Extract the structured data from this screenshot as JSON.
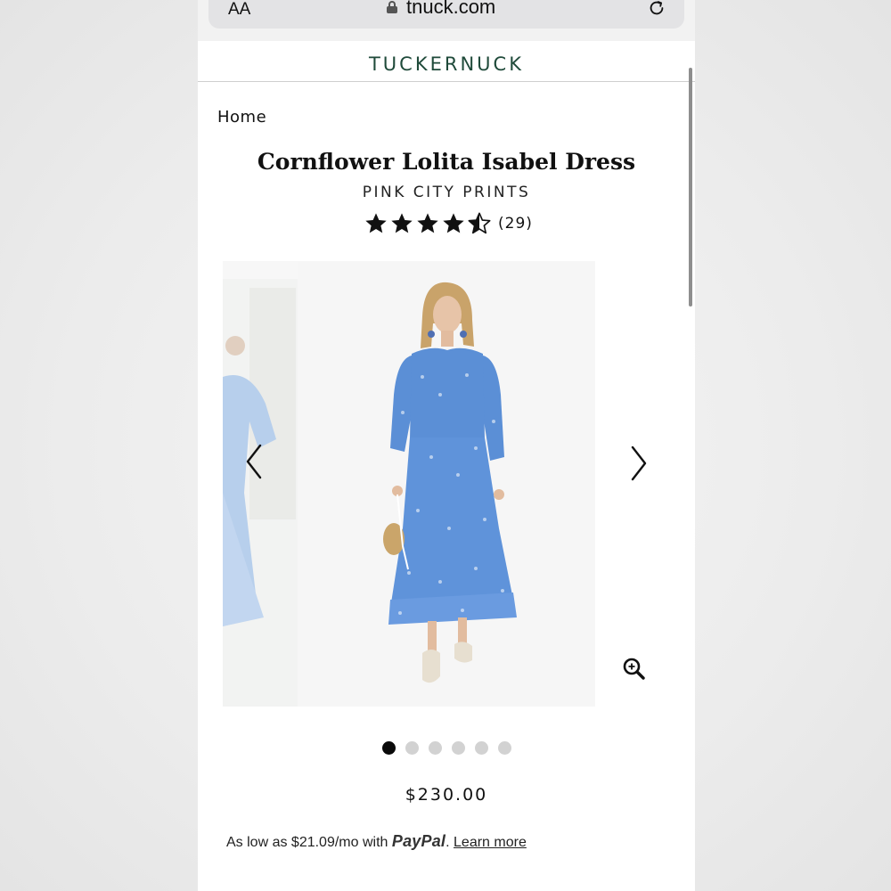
{
  "browser": {
    "text_size_label": "AA",
    "domain": "tnuck.com",
    "lock_icon": "lock-icon",
    "reload_icon": "reload-icon"
  },
  "header": {
    "brand": "TUCKERNUCK"
  },
  "breadcrumb": {
    "home": "Home"
  },
  "product": {
    "title": "Cornflower Lolita Isabel Dress",
    "designer": "PINK CITY PRINTS",
    "rating": {
      "value": 4.5,
      "max": 5,
      "count_label": "(29)"
    },
    "price": "$230.00"
  },
  "gallery": {
    "slide_count": 6,
    "active_index": 0,
    "prev_icon": "chevron-left-icon",
    "next_icon": "chevron-right-icon",
    "zoom_icon": "zoom-in-icon",
    "dress_color": "#5b8fd6"
  },
  "financing": {
    "prefix": "As low as $21.09/mo with",
    "provider": "PayPal",
    "separator": ".",
    "link": "Learn more"
  },
  "colors": {
    "brand_green": "#1f4a3a"
  }
}
